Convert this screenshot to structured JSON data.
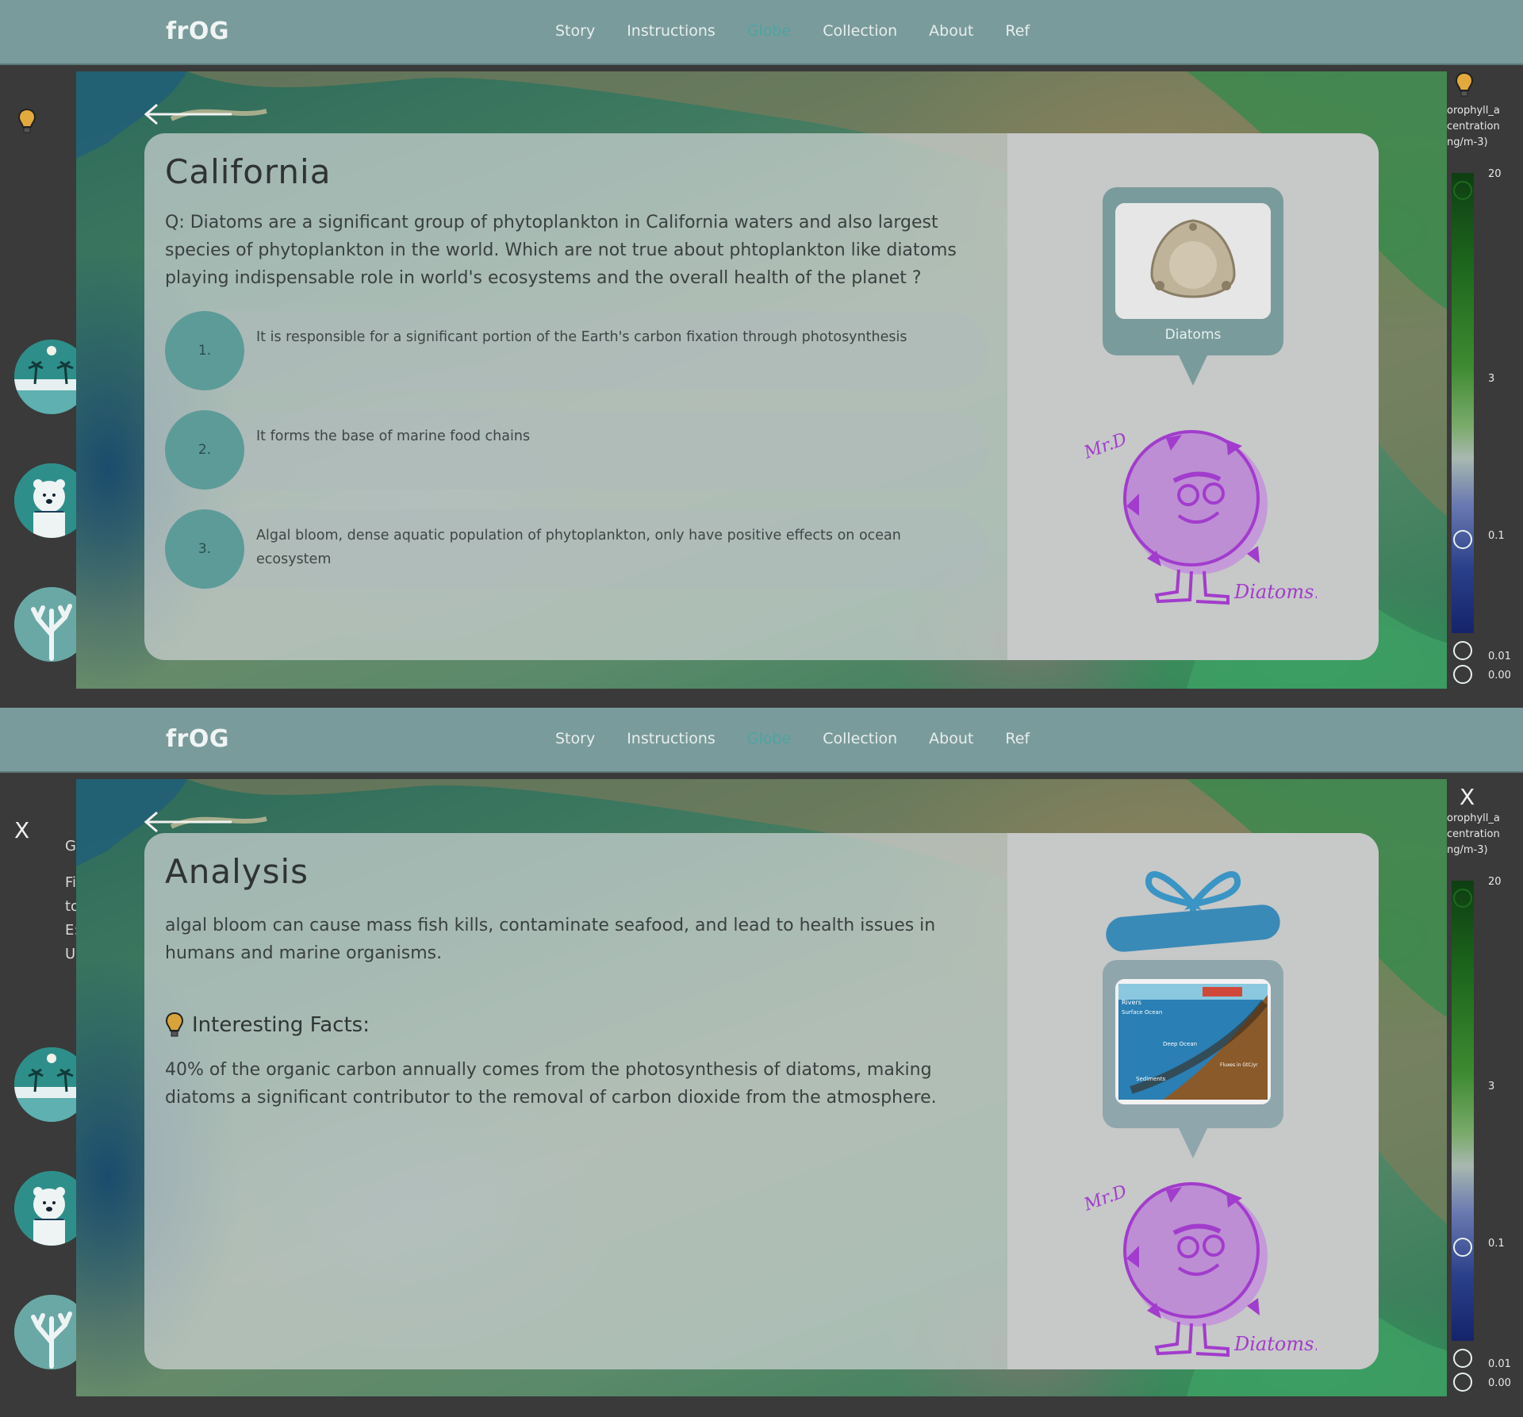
{
  "app": {
    "logo": "frOG",
    "nav": [
      "Story",
      "Instructions",
      "Globe",
      "Collection",
      "About",
      "Ref"
    ],
    "active_nav": "Globe"
  },
  "legend": {
    "title_lines": [
      "orophyll_a",
      "centration",
      "ng/m-3)"
    ],
    "ticks": [
      "20",
      "3",
      "0.1",
      "0.01",
      "0.00"
    ]
  },
  "quiz": {
    "title": "California",
    "question": "Q: Diatoms are a significant group of phytoplankton in California waters and also largest species of phytoplankton in the world. Which are not true about phtoplankton like diatoms playing indispensable role in world's ecosystems and the overall health of the planet ?",
    "options": [
      {
        "num": "1.",
        "text": "It is responsible for a significant portion of the Earth's carbon fixation through photosynthesis"
      },
      {
        "num": "2.",
        "text": "It forms the base of marine food chains"
      },
      {
        "num": "3.",
        "text": "Algal bloom, dense aquatic population of phytoplankton, only have positive effects on ocean ecosystem"
      }
    ],
    "card_label": "Diatoms",
    "mascot_name": "Mr.D",
    "mascot_caption": "Diatoms."
  },
  "analysis": {
    "title": "Analysis",
    "text": "algal bloom can cause mass fish kills, contaminate seafood, and lead to health issues in humans and marine organisms.",
    "facts_heading": "Interesting Facts:",
    "facts_text": "40% of the organic carbon annually comes from the photosynthesis of diatoms, making diatoms a significant contributor to the removal of carbon dioxide from the atmosphere.",
    "close_label": "X",
    "side_text": [
      "G",
      "Fi",
      "to",
      "E:",
      "U"
    ],
    "diagram_labels": [
      "Rivers",
      "Surface Ocean",
      "Deep Ocean",
      "Sediments",
      "Fluxes in GtC/yr"
    ],
    "mascot_name": "Mr.D",
    "mascot_caption": "Diatoms."
  },
  "colors": {
    "navbar": "#7a9b9b",
    "accent_teal": "#5c9b98",
    "mascot_purple": "#a23ccc"
  }
}
